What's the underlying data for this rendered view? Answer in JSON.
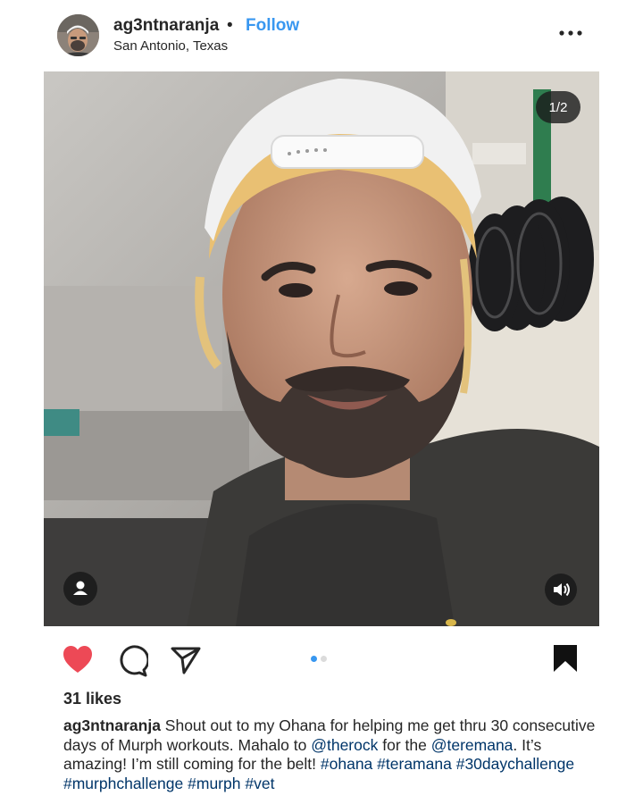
{
  "post": {
    "username": "ag3ntnaranja",
    "separator": "•",
    "follow_label": "Follow",
    "location": "San Antonio, Texas"
  },
  "media": {
    "counter": "1/2"
  },
  "actions": {
    "liked": true,
    "like_color": "#ed4956",
    "pager_active": 1,
    "pager_total": 2
  },
  "stats": {
    "likes": "31 likes"
  },
  "caption": {
    "username": "ag3ntnaranja",
    "text_1": " Shout out to my Ohana for helping me get thru 30 consecutive days of Murph workouts. Mahalo to ",
    "mention_1": "@therock",
    "text_2": " for the ",
    "mention_2": "@teremana",
    "text_3": ". It’s amazing!  I’m still coming for the belt! ",
    "hashtags": [
      "#ohana",
      "#teramana",
      "#30daychallenge",
      "#murphchallenge",
      "#murph",
      "#vet"
    ]
  },
  "icons": {
    "more": "more-options-icon",
    "like": "heart-icon",
    "comment": "comment-icon",
    "share": "send-icon",
    "save": "bookmark-icon",
    "user_tag": "user-tag-icon",
    "volume": "volume-icon"
  },
  "colors": {
    "link": "#003569",
    "follow": "#3897f0",
    "pager_active": "#3897f0",
    "pager_inactive": "#dbdbdb"
  }
}
